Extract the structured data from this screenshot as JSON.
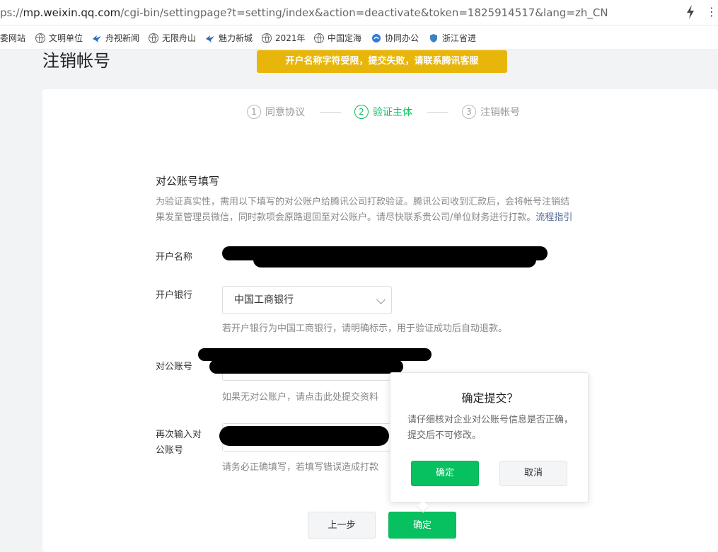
{
  "browser": {
    "url_prefix": "ps://",
    "url_host": "mp.weixin.qq.com",
    "url_path": "/cgi-bin/settingpage?t=setting/index&action=deactivate&token=1825914517&lang=zh_CN",
    "menu_glyph": "⋮",
    "bookmarks": [
      "委网站",
      "文明单位",
      "舟视新闻",
      "无限舟山",
      "魅力新城",
      "2021年",
      "中国定海",
      "协同办公",
      "浙江省进"
    ]
  },
  "page": {
    "title": "注销帐号",
    "toast": "开户名称字符受限，提交失败，请联系腾讯客服"
  },
  "steps": [
    {
      "num": "1",
      "label": "同意协议"
    },
    {
      "num": "2",
      "label": "验证主体"
    },
    {
      "num": "3",
      "label": "注销帐号"
    }
  ],
  "form": {
    "section_title": "对公账号填写",
    "desc_line1": "为验证真实性，需用以下填写的对公账户给腾讯公司打款验证。腾讯公司收到汇款后，会将帐号注销结",
    "desc_line2": "果发至管理员微信，同时款项会原路退回至对公账户。请尽快联系贵公司/单位财务进行打款。",
    "flow_link": "流程指引",
    "account_name_label": "开户名称",
    "bank_label": "开户银行",
    "bank_value": "中国工商银行",
    "bank_hint": "若开户银行为中国工商银行，请明确标示，用于验证成功后自动退款。",
    "account_no_label": "对公账号",
    "account_no_hint": "如果无对公账户，请点击此处提交资料",
    "reenter_label_1": "再次输入对",
    "reenter_label_2": "公账号",
    "reenter_hint": "请务必正确填写，若填写错误造成打款"
  },
  "buttons": {
    "prev": "上一步",
    "confirm": "确定"
  },
  "popover": {
    "title": "确定提交？",
    "text": "请仔细核对企业对公账号信息是否正确，提交后不可修改。",
    "ok": "确定",
    "cancel": "取消"
  },
  "colors": {
    "accent": "#07c160",
    "toast": "#e8b60b"
  }
}
